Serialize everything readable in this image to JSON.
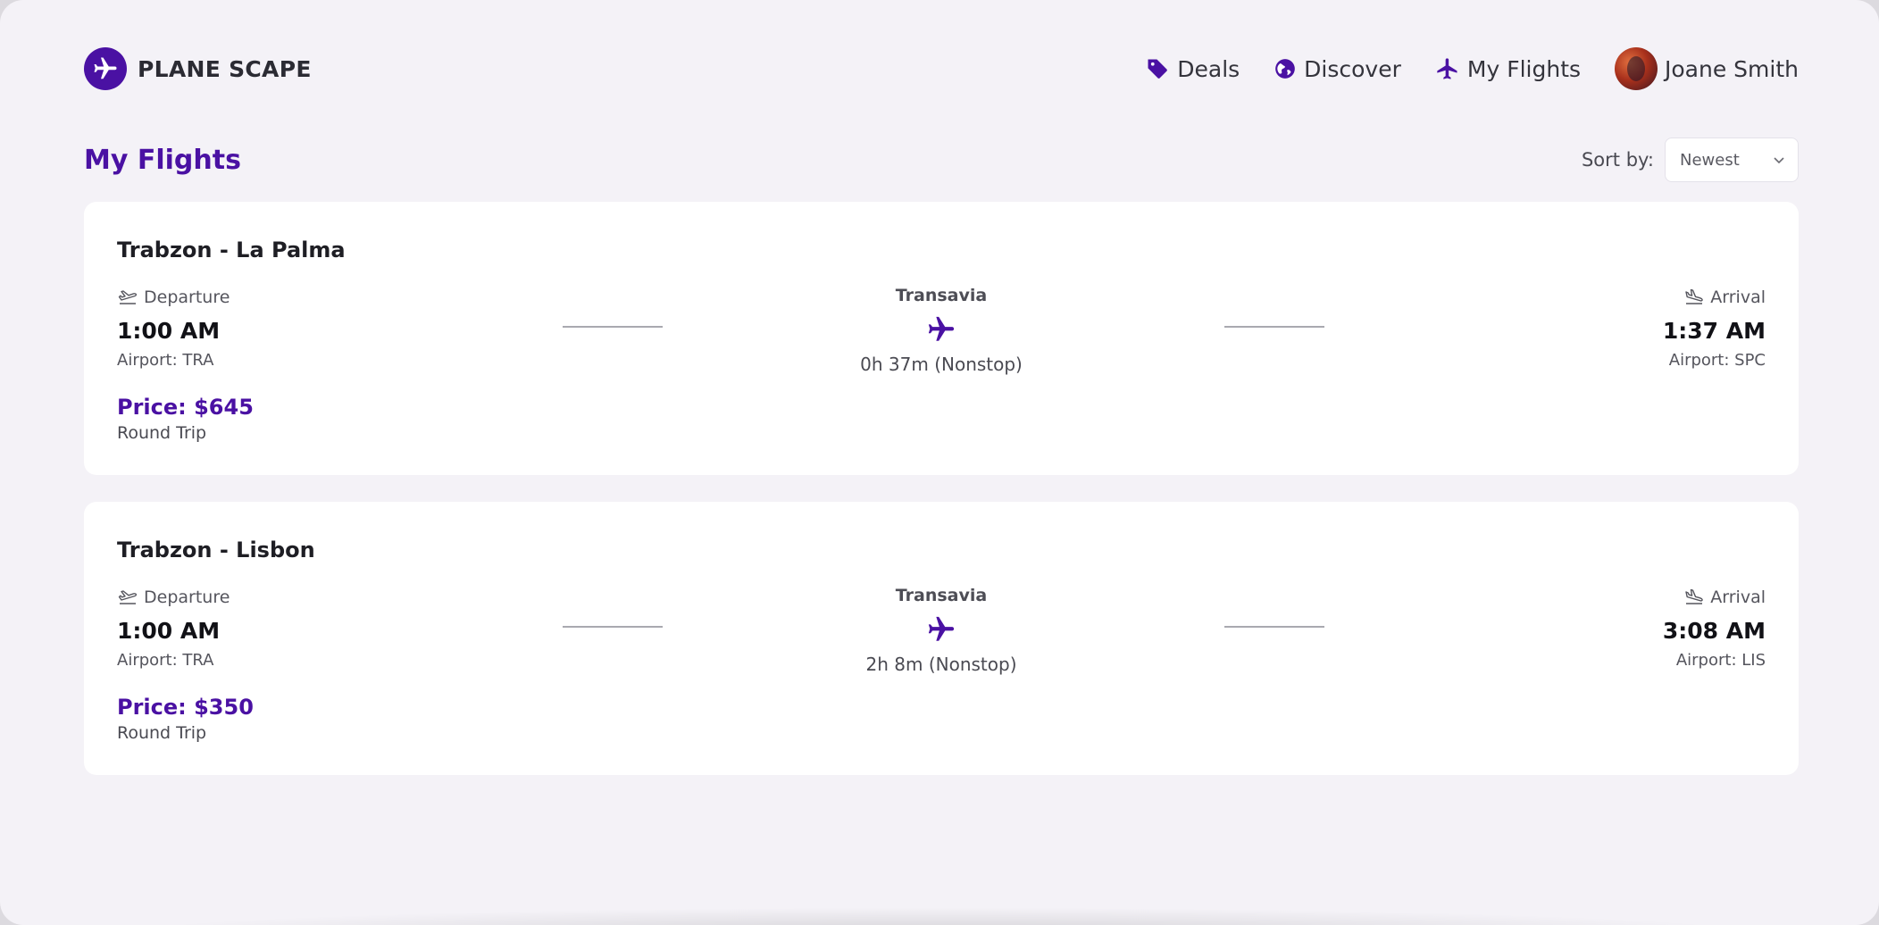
{
  "brand": {
    "name": "PLANE SCAPE"
  },
  "nav": {
    "deals": "Deals",
    "discover": "Discover",
    "my_flights": "My Flights",
    "user_name": "Joane Smith"
  },
  "page": {
    "title": "My Flights",
    "sort_label": "Sort by:",
    "sort_value": "Newest"
  },
  "colors": {
    "accent": "#4a11a3",
    "background": "#f4f2f7",
    "card": "#ffffff"
  },
  "flights": [
    {
      "route": "Trabzon - La Palma",
      "departure_label": "Departure",
      "departure_time": "1:00 AM",
      "departure_airport": "Airport: TRA",
      "airline": "Transavia",
      "duration": "0h 37m (Nonstop)",
      "arrival_label": "Arrival",
      "arrival_time": "1:37 AM",
      "arrival_airport": "Airport: SPC",
      "price": "Price: $645",
      "trip_type": "Round Trip"
    },
    {
      "route": "Trabzon - Lisbon",
      "departure_label": "Departure",
      "departure_time": "1:00 AM",
      "departure_airport": "Airport: TRA",
      "airline": "Transavia",
      "duration": "2h 8m (Nonstop)",
      "arrival_label": "Arrival",
      "arrival_time": "3:08 AM",
      "arrival_airport": "Airport: LIS",
      "price": "Price: $350",
      "trip_type": "Round Trip"
    }
  ]
}
